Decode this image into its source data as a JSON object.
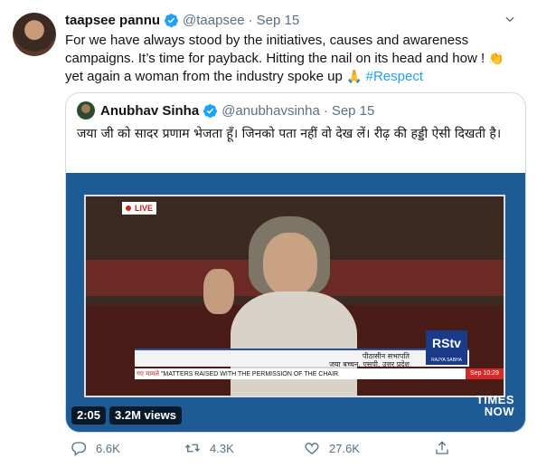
{
  "tweet": {
    "author_name": "taapsee pannu",
    "author_handle": "@taapsee",
    "separator": "·",
    "date": "Sep 15",
    "text_lines": [
      "For we have always stood by the initiatives, causes and awareness",
      "campaigns. It’s time for payback. Hitting the nail on its head and how !",
      "yet again a woman from the industry spoke up"
    ],
    "emoji_clap": "👏",
    "emoji_pray": "🙏",
    "hashtag": "#Respect",
    "icons": {
      "avatar": "avatar",
      "verified": "verified-badge-icon",
      "more": "chevron-down-icon"
    }
  },
  "quote": {
    "author_name": "Anubhav Sinha",
    "author_handle": "@anubhavsinha",
    "separator": "·",
    "date": "Sep 15",
    "text": "जया जी को सादर प्रणाम भेजता हूँ। जिनको पता नहीं वो देख लें। रीढ़ की हड्डी ऐसी दिखती है।"
  },
  "video": {
    "duration": "2:05",
    "views": "3.2M views",
    "live_label": "LIVE",
    "lower_third_name": "जया बच्चन, एसपी, उत्तर प्रदेश",
    "lower_third_role": "पीठासीन   सभापति",
    "channel_logo": "RStv",
    "channel_sub": "RAJYA SABHA",
    "ticker_prefix": "गए मामले",
    "ticker_text": "\"MATTERS RAISED WITH THE PERMISSION OF THE CHAIR",
    "ticker_time": "Sep 10:29",
    "watermark_line1": "TIMES",
    "watermark_line2": "NOW"
  },
  "actions": {
    "reply_count": "6.6K",
    "retweet_count": "4.3K",
    "like_count": "27.6K",
    "icons": [
      "reply-icon",
      "retweet-icon",
      "like-icon",
      "share-icon"
    ]
  },
  "colors": {
    "text": "#0f1419",
    "muted": "#5b7083",
    "accent": "#1da1f2",
    "border": "#cfd9de"
  }
}
